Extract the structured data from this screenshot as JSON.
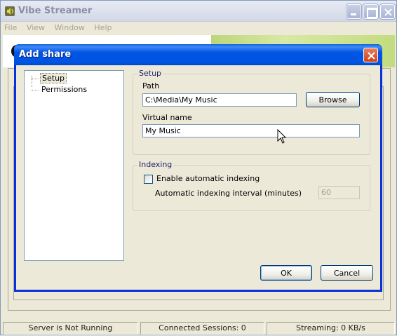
{
  "main_window": {
    "title": "Vibe Streamer",
    "app_icon": "speaker-icon",
    "menu": [
      "File",
      "View",
      "Window",
      "Help"
    ]
  },
  "status_bar": {
    "server": "Server is Not Running",
    "sessions": "Connected Sessions: 0",
    "streaming": "Streaming: 0 KB/s"
  },
  "dialog": {
    "title": "Add share",
    "tree": [
      {
        "label": "Setup",
        "selected": true
      },
      {
        "label": "Permissions",
        "selected": false
      }
    ],
    "setup": {
      "group_label": "Setup",
      "path_label": "Path",
      "path_value": "C:\\Media\\My Music",
      "browse_label": "Browse",
      "virtual_name_label": "Virtual name",
      "virtual_name_value": "My Music"
    },
    "indexing": {
      "group_label": "Indexing",
      "enable_label": "Enable automatic indexing",
      "enable_checked": false,
      "interval_label": "Automatic indexing interval (minutes)",
      "interval_value": "60"
    },
    "ok_label": "OK",
    "cancel_label": "Cancel"
  },
  "colors": {
    "dialog_title": "#0054e3",
    "window_bg": "#ece9d8",
    "banner_green": "#c3dc7f"
  }
}
